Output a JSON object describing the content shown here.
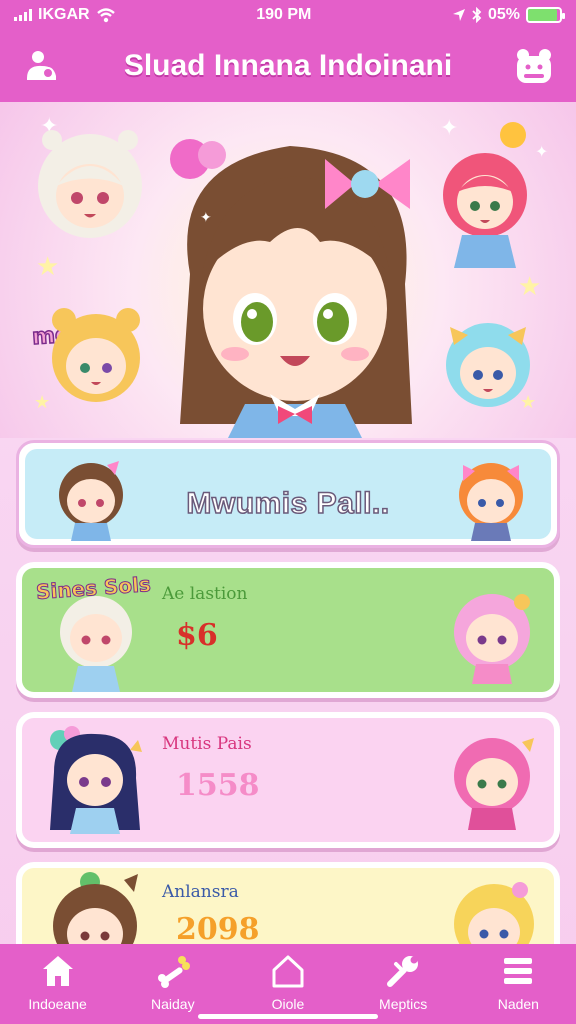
{
  "status_bar": {
    "carrier": "IKGAR",
    "time": "190 PM",
    "battery_percent": "05%",
    "battery_level": 0.9
  },
  "header": {
    "title": "Sluad Innana Indoinani",
    "left_icon": "user-settings-icon",
    "right_icon": "character-face-icon"
  },
  "hero": {
    "sticker_text": "mgaoqi"
  },
  "cards": [
    {
      "title": "Mwumis Pall.."
    },
    {
      "sticker": "Sines Sols",
      "label": "Ae lastion",
      "value": "$6",
      "label_color": "#4b9a3a",
      "value_color": "#d8302a"
    },
    {
      "label": "Mutis Pais",
      "value": "1558",
      "label_color": "#d8367e",
      "value_color": "#f58cc8"
    },
    {
      "label": "Anlansra",
      "value": "2098",
      "label_color": "#3a5aa8",
      "value_color": "#f5a02a"
    }
  ],
  "bottom_nav": [
    {
      "label": "Indoeane",
      "icon": "home-icon"
    },
    {
      "label": "Naiday",
      "icon": "dog-bone-icon"
    },
    {
      "label": "Oiole",
      "icon": "house-outline-icon"
    },
    {
      "label": "Meptics",
      "icon": "wrench-icon"
    },
    {
      "label": "Naden",
      "icon": "menu-icon"
    }
  ],
  "colors": {
    "primary": "#e45fc9",
    "background": "#f7c8ee"
  }
}
